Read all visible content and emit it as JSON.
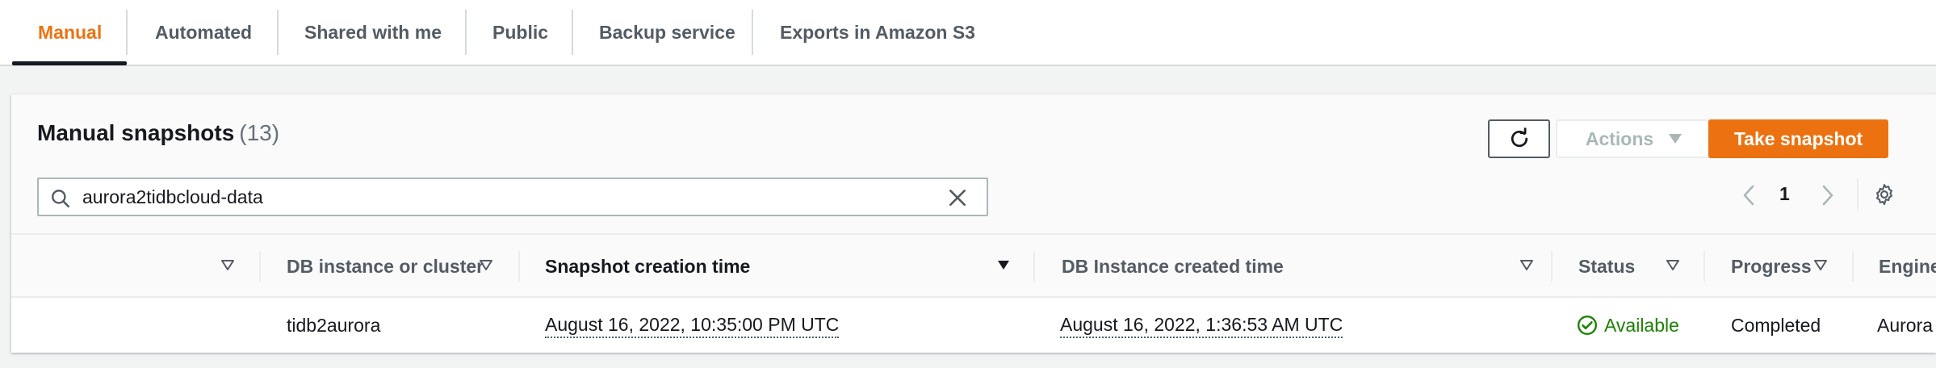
{
  "tabs": [
    {
      "label": "Manual",
      "active": true
    },
    {
      "label": "Automated",
      "active": false
    },
    {
      "label": "Shared with me",
      "active": false
    },
    {
      "label": "Public",
      "active": false
    },
    {
      "label": "Backup service",
      "active": false
    },
    {
      "label": "Exports in Amazon S3",
      "active": false
    }
  ],
  "panel": {
    "title": "Manual snapshots",
    "count": "(13)",
    "actions_label": "Actions",
    "take_snapshot_label": "Take snapshot"
  },
  "search": {
    "value": "aurora2tidbcloud-data"
  },
  "pagination": {
    "current_page": "1"
  },
  "table": {
    "columns": [
      "",
      "DB instance or cluster",
      "Snapshot creation time",
      "DB Instance created time",
      "Status",
      "Progress",
      "Engine"
    ],
    "sorted_column": "Snapshot creation time",
    "rows": [
      {
        "db_instance": "tidb2aurora",
        "snapshot_time": "August 16, 2022, 10:35:00 PM UTC",
        "instance_created": "August 16, 2022, 1:36:53 AM UTC",
        "status": "Available",
        "progress": "Completed",
        "engine": "Aurora"
      }
    ]
  },
  "colors": {
    "accent": "#ec7211",
    "success": "#1d8102",
    "text": "#16191f",
    "muted": "#545b64"
  },
  "icons": [
    "search-icon",
    "clear-icon",
    "refresh-icon",
    "caret-down-icon",
    "chevron-left-icon",
    "chevron-right-icon",
    "gear-icon",
    "status-check-icon"
  ]
}
